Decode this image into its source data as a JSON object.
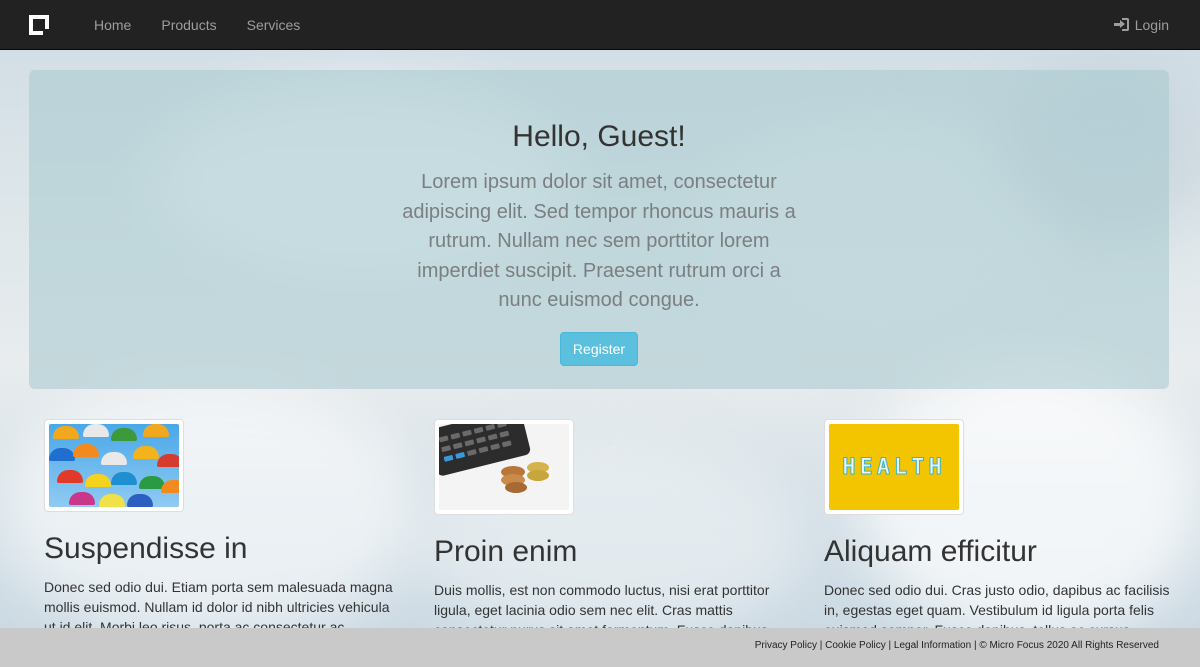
{
  "navbar": {
    "brand_icon": "logo-square-icon",
    "links": [
      "Home",
      "Products",
      "Services"
    ],
    "login_label": "Login",
    "login_icon": "sign-in-icon"
  },
  "jumbotron": {
    "title": "Hello, Guest!",
    "text": "Lorem ipsum dolor sit amet, consectetur adipiscing elit. Sed tempor rhoncus mauris a rutrum. Nullam nec sem porttitor lorem imperdiet suscipit. Praesent rutrum orci a nunc euismod congue.",
    "button_label": "Register",
    "button_color": "#5bc0de"
  },
  "columns": [
    {
      "image": "umbrellas-image",
      "title": "Suspendisse in",
      "text": "Donec sed odio dui. Etiam porta sem malesuada magna mollis euismod. Nullam id dolor id nibh ultricies vehicula ut id elit. Morbi leo risus, porta ac consectetur ac"
    },
    {
      "image": "calculator-coins-image",
      "title": "Proin enim",
      "text": "Duis mollis, est non commodo luctus, nisi erat porttitor ligula, eget lacinia odio sem nec elit. Cras mattis consectetur purus sit amet fermentum. Fusce dapibus"
    },
    {
      "image": "health-pills-image",
      "title": "Aliquam efficitur",
      "text": "Donec sed odio dui. Cras justo odio, dapibus ac facilisis in, egestas eget quam. Vestibulum id ligula porta felis euismod semper. Fusce dapibus, tellus ac cursus"
    }
  ],
  "health_word": "HEALTH",
  "footer": {
    "privacy": "Privacy Policy",
    "cookie": "Cookie Policy",
    "legal": "Legal Information",
    "copyright": "© Micro Focus 2020 All Rights Reserved",
    "sep": " | "
  }
}
